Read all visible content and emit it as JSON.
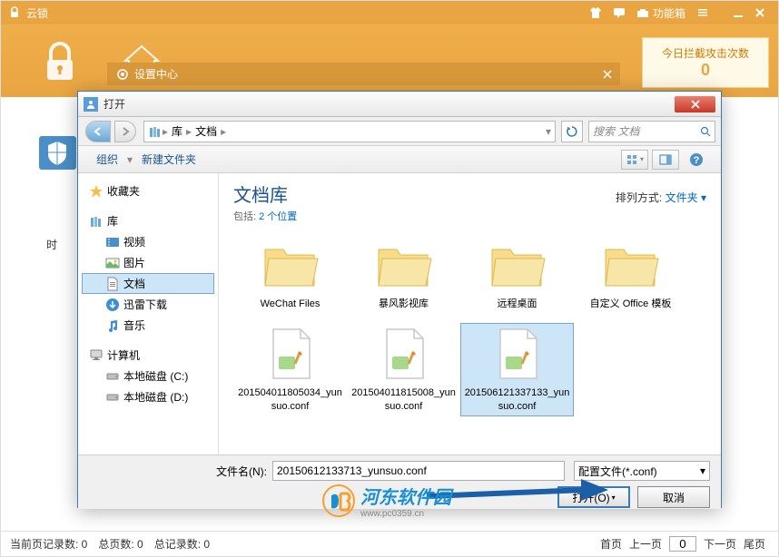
{
  "app": {
    "title": "云锁",
    "toolbox_label": "功能箱",
    "stats": {
      "label": "今日拦截攻击次数",
      "value": "0"
    }
  },
  "settings_window": {
    "title": "设置中心"
  },
  "time_label": "时",
  "status": {
    "current_records": "当前页记录数: 0",
    "total_pages": "总页数: 0",
    "total_records": "总记录数: 0",
    "first_page": "首页",
    "prev_page": "上一页",
    "page_value": "0",
    "next_page": "下一页",
    "last_page": "尾页"
  },
  "dialog": {
    "title": "打开",
    "nav": {
      "crumb1": "库",
      "crumb2": "文档",
      "search_placeholder": "搜索 文档"
    },
    "toolbar": {
      "organize": "组织",
      "new_folder": "新建文件夹"
    },
    "sidebar": {
      "favorites": "收藏夹",
      "library": "库",
      "videos": "视频",
      "pictures": "图片",
      "documents": "文档",
      "xunlei": "迅雷下载",
      "music": "音乐",
      "computer": "计算机",
      "disk_c": "本地磁盘 (C:)",
      "disk_d": "本地磁盘 (D:)"
    },
    "content": {
      "lib_title": "文档库",
      "lib_sub_prefix": "包括: ",
      "lib_sub_link": "2 个位置",
      "sort_label": "排列方式:",
      "sort_value": "文件夹",
      "items": [
        {
          "name": "WeChat Files",
          "type": "folder"
        },
        {
          "name": "暴风影视库",
          "type": "folder"
        },
        {
          "name": "远程桌面",
          "type": "folder"
        },
        {
          "name": "自定义 Office 模板",
          "type": "folder"
        },
        {
          "name": "201504011805034_yunsuo.conf",
          "type": "file"
        },
        {
          "name": "201504011815008_yunsuo.conf",
          "type": "file"
        },
        {
          "name": "201506121337133_yunsuo.conf",
          "type": "file",
          "selected": true
        }
      ]
    },
    "bottom": {
      "filename_label": "文件名(N):",
      "filename_value": "20150612133713_yunsuo.conf",
      "filetype": "配置文件(*.conf)",
      "open_btn": "打开(O)",
      "cancel_btn": "取消"
    }
  },
  "watermark": {
    "text": "河东软件园",
    "url": "www.pc0359.cn"
  }
}
